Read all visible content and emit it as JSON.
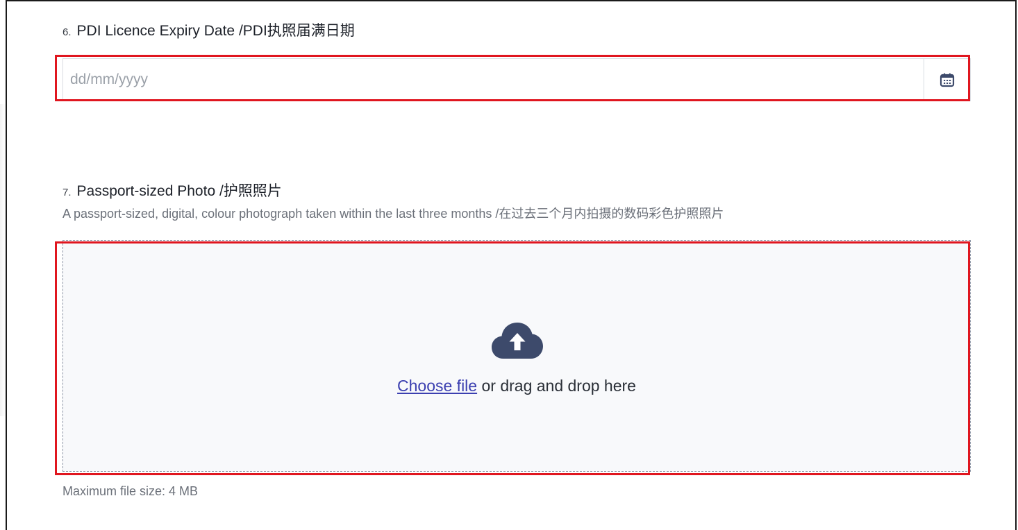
{
  "question6": {
    "number": "6.",
    "title": "PDI Licence Expiry Date /PDI执照届满日期",
    "date_placeholder": "dd/mm/yyyy",
    "date_value": ""
  },
  "question7": {
    "number": "7.",
    "title": "Passport-sized Photo /护照照片",
    "description": "A passport-sized, digital, colour photograph taken within the last three months /在过去三个月内拍摄的数码彩色护照照片",
    "choose_file_label": "Choose file",
    "drag_text": " or drag and drop here",
    "max_size": "Maximum file size: 4 MB"
  },
  "icons": {
    "calendar": "calendar-icon",
    "upload": "cloud-upload-icon"
  },
  "colors": {
    "highlight": "#e0161f",
    "link": "#3b3fb0",
    "icon": "#3d4a6b"
  }
}
